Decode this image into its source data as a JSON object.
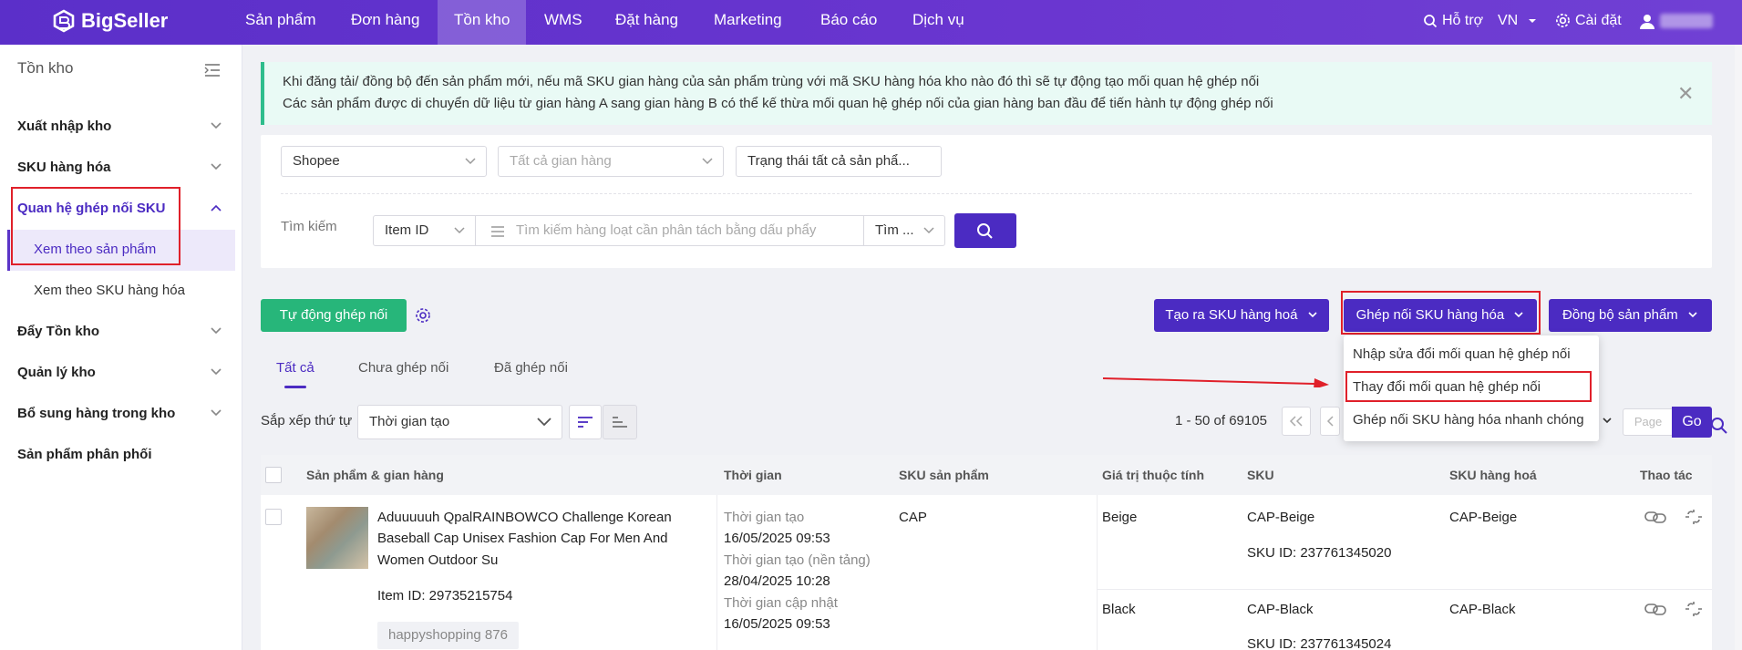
{
  "app": {
    "logo_text": "BigSeller"
  },
  "nav": {
    "items": [
      "Sản phẩm",
      "Đơn hàng",
      "Tồn kho",
      "WMS",
      "Đặt hàng",
      "Marketing",
      "Báo cáo",
      "Dịch vụ"
    ],
    "active": "Tồn kho",
    "support": "Hỗ trợ",
    "language": "VN",
    "settings": "Cài đặt"
  },
  "sidebar": {
    "title": "Tồn kho",
    "items": [
      {
        "label": "Xuất nhập kho"
      },
      {
        "label": "SKU hàng hóa"
      },
      {
        "label": "Quan hệ ghép nối SKU"
      },
      {
        "label": "Đẩy Tồn kho"
      },
      {
        "label": "Quản lý kho"
      },
      {
        "label": "Bổ sung hàng trong kho"
      },
      {
        "label": "Sản phẩm phân phối"
      }
    ],
    "subitems": [
      "Xem theo sản phẩm",
      "Xem theo SKU hàng hóa"
    ]
  },
  "notice": {
    "line1": "Khi đăng tải/ đồng bộ đến sản phẩm mới, nếu mã SKU gian hàng của sản phẩm trùng với mã SKU hàng hóa kho nào đó thì sẽ tự động tạo mối quan hệ ghép nối",
    "line2": "Các sản phẩm được di chuyển dữ liệu từ gian hàng A sang gian hàng B có thể kế thừa mối quan hệ ghép nối của gian hàng ban đầu để tiến hành tự động ghép nối"
  },
  "filters": {
    "platform": "Shopee",
    "store_placeholder": "Tất cả gian hàng",
    "status": "Trạng thái tất cả sản phẩ...",
    "search_label": "Tìm kiếm",
    "search_type": "Item ID",
    "search_placeholder": "Tìm kiếm hàng loạt cần phân tách bằng dấu phẩy",
    "search_mode": "Tìm ..."
  },
  "actions": {
    "auto_match": "Tự động ghép nối",
    "create_sku": "Tạo ra SKU hàng hoá",
    "match_sku": "Ghép nối SKU hàng hóa",
    "sync_products": "Đồng bộ sản phẩm"
  },
  "dropdown": {
    "items": [
      "Nhập sửa đổi mối quan hệ ghép nối",
      "Thay đổi mối quan hệ ghép nối",
      "Ghép nối SKU hàng hóa nhanh chóng"
    ]
  },
  "tabs": [
    "Tất cả",
    "Chưa ghép nối",
    "Đã ghép nối"
  ],
  "sort": {
    "label": "Sắp xếp thứ tự",
    "value": "Thời gian tạo"
  },
  "pagination": {
    "range": "1 - 50 of 69105",
    "page_placeholder": "Page",
    "go": "Go"
  },
  "table": {
    "headers": [
      "Sản phẩm & gian hàng",
      "Thời gian",
      "SKU sản phẩm",
      "Giá trị thuộc tính",
      "SKU",
      "SKU hàng hoá",
      "Thao tác"
    ],
    "row": {
      "title_lines": [
        "Aduuuuuh QpalRAINBOWCO Challenge Korean",
        "Baseball Cap Unisex Fashion Cap For Men And",
        "Women Outdoor Su"
      ],
      "item_id": "Item ID: 29735215754",
      "store": "happyshopping 876",
      "times": [
        {
          "label": "Thời gian tạo",
          "value": "16/05/2025 09:53"
        },
        {
          "label": "Thời gian tạo (nền tảng)",
          "value": "28/04/2025 10:28"
        },
        {
          "label": "Thời gian cập nhật",
          "value": "16/05/2025 09:53"
        }
      ],
      "product_sku": "CAP",
      "variants": [
        {
          "attr": "Beige",
          "sku": "CAP-Beige",
          "sku_id": "SKU ID: 237761345020",
          "merchant_sku": "CAP-Beige"
        },
        {
          "attr": "Black",
          "sku": "CAP-Black",
          "sku_id": "SKU ID: 237761345024",
          "merchant_sku": "CAP-Black"
        }
      ]
    }
  },
  "colors": {
    "brand": "#5b2fc9",
    "primary": "#4b2bc2",
    "success": "#27b67a",
    "highlight": "#e0202a"
  }
}
